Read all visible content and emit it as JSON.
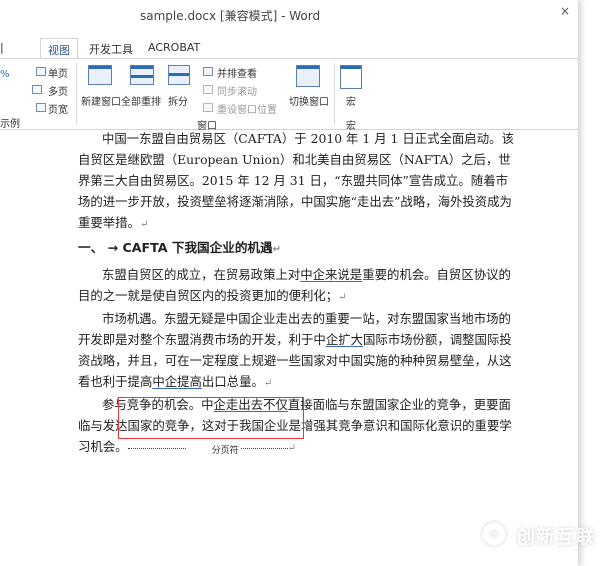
{
  "window": {
    "title": "sample.docx [兼容模式] - Word",
    "close_glyph": "×"
  },
  "tabs": [
    {
      "label": "视图",
      "active": true
    },
    {
      "label": "开发工具",
      "active": false
    },
    {
      "label": "ACROBAT",
      "active": false
    }
  ],
  "ribbon": {
    "left_edge": {
      "pct": "%",
      "group_partial": "示例"
    },
    "zoom_items": [
      "单页",
      "多页",
      "页宽"
    ],
    "window_buttons": {
      "new_window": "新建窗口",
      "arrange_all": "全部重排",
      "split": "拆分"
    },
    "window_small": {
      "side_by_side": "并排查看",
      "sync_scroll": "同步滚动",
      "reset_pos": "重设窗口位置"
    },
    "switch_window": "切换窗口",
    "macros": "宏",
    "group_window": "窗口",
    "group_macros": "宏"
  },
  "document": {
    "p1": "中国一东盟自由贸易区（CAFTA）于 2010 年 1 月 1 日正式全面启动。该自贸区是继欧盟（European Union）和北美自由贸易区（NAFTA）之后，世界第三大自由贸易区。2015 年 12 月 31 日，“东盟共同体”宣告成立。随着市场的进一步开放，投资壁垒将逐渐消除，中国实施“走出去”战略，海外投资成为重要举措。",
    "heading_num": "一、",
    "heading_arrow": "→",
    "heading_text": "CAFTA 下我国企业的机遇",
    "p2a": "东盟自贸区的成立，在贸易政策上对",
    "p2u": "中企来说是",
    "p2b": "重要的机会。自贸区协议的目的之一就是使自贸区内的投资更加的便利化；",
    "p3a": "市场机遇。东盟无疑是中国企业走出去的重要一站，对东盟国家当地市场的开发即是对整个东盟消费市场的开发，利于中",
    "p3u1": "企扩大",
    "p3b": "国际市场份额，调整国际投资战略，并且，可在一定程度上规避一些国家对中国实施的种种贸易壁垒，从这看也利于提高",
    "p3u2": "中企提高",
    "p3c": "出口总量。",
    "p4a": "参与竞争的机会。中",
    "p4u": "企走出去不仅",
    "p4b": "直接面临与东盟国家企业的竞争，更要面临与发达国家的竞争，这对于我国企业是增强其竞争意识和国际化意识的重要学习机会。",
    "page_break_label": "分页符",
    "para_mark": "↵"
  },
  "watermark": "创新互联",
  "colors": {
    "accent": "#2b579a",
    "highlight_box": "#e53935"
  }
}
